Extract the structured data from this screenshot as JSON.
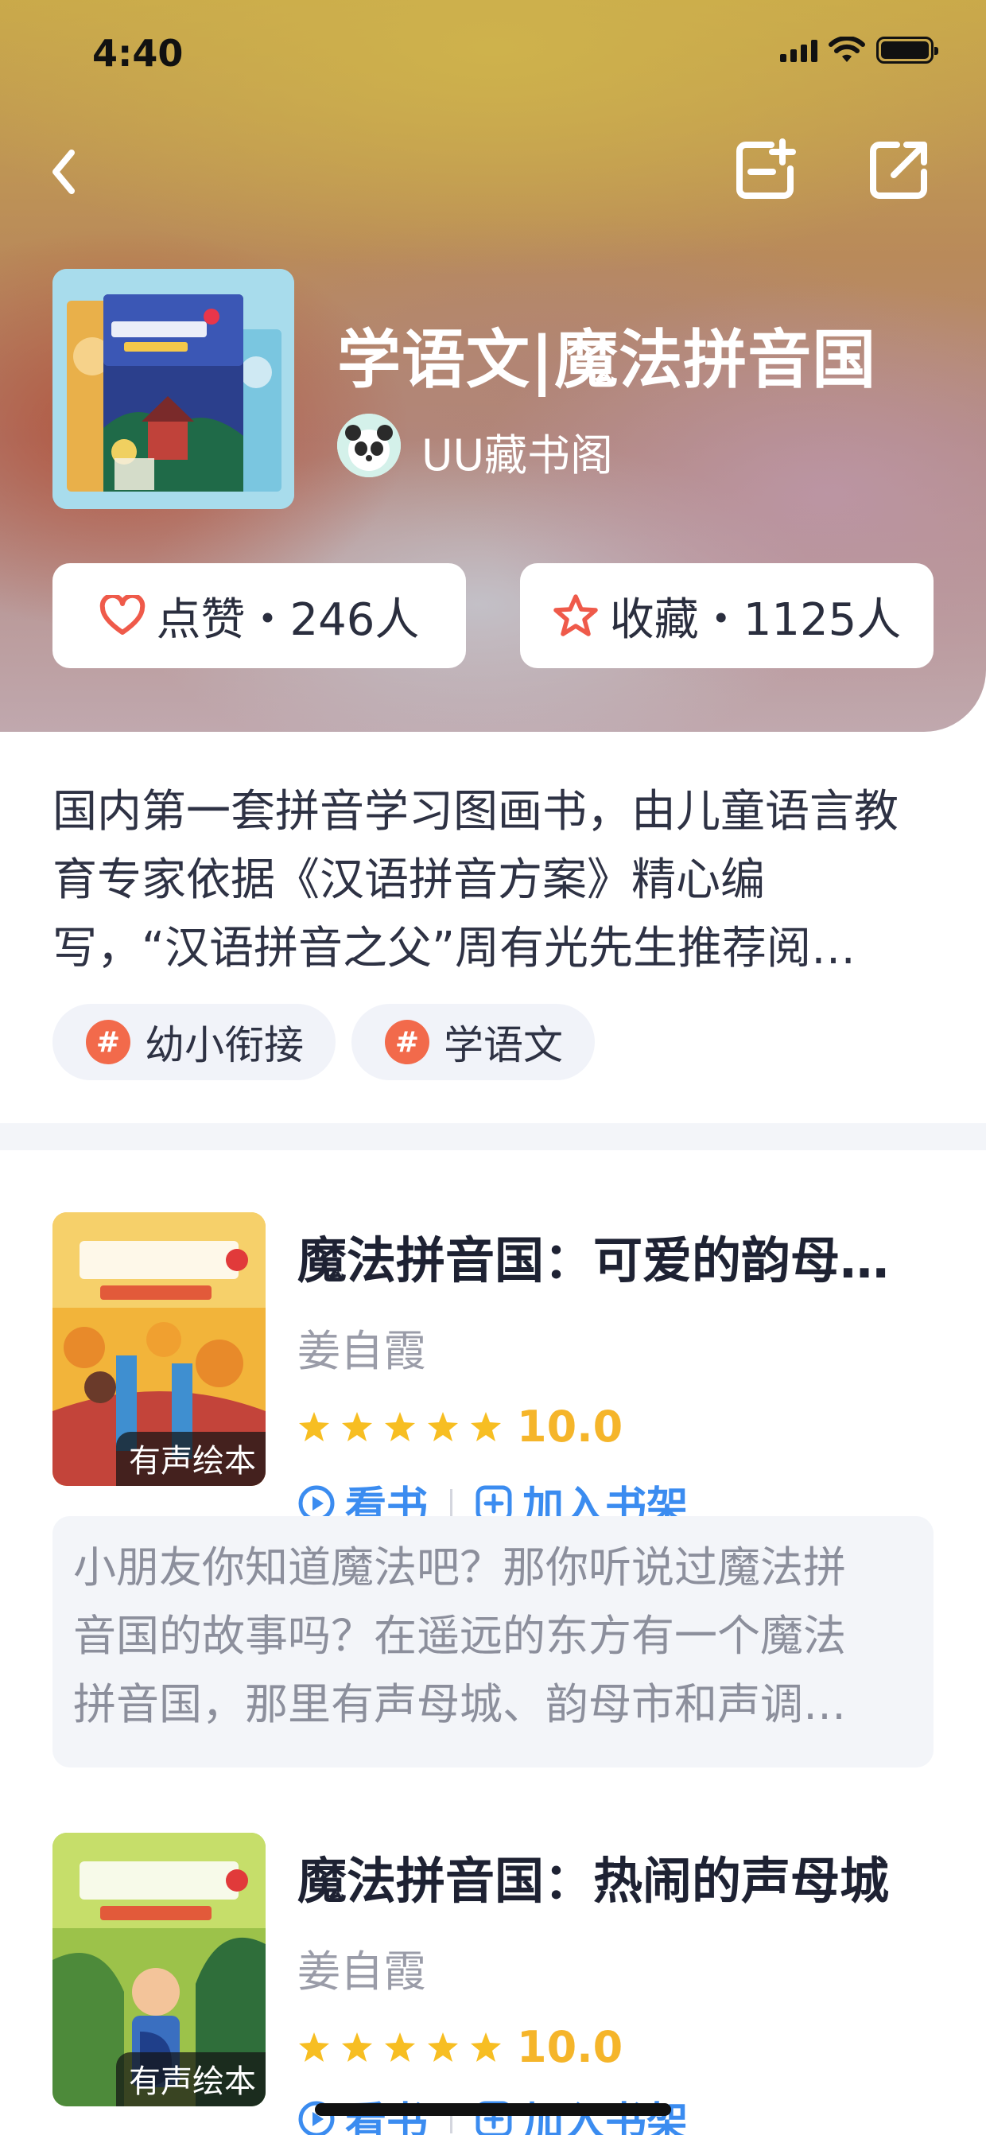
{
  "status_bar": {
    "time": "4:40"
  },
  "header": {
    "title": "学语文|魔法拼音国",
    "author": "UU藏书阁",
    "like_label": "点赞・246人",
    "fav_label": "收藏・1125人"
  },
  "description": {
    "lines": [
      "国内第一套拼音学习图画书，由儿童语言教",
      "育专家依据《汉语拼音方案》精心编",
      "写，“汉语拼音之父”周有光先生推荐阅…"
    ],
    "tags": [
      "幼小衔接",
      "学语文"
    ]
  },
  "books": [
    {
      "title": "魔法拼音国：可爱的韵母…",
      "author": "姜自霞",
      "badge": "有声绘本",
      "rating": "10.0",
      "read_label": "看书",
      "shelf_label": "加入书架",
      "summary": [
        "小朋友你知道魔法吧？那你听说过魔法拼",
        "音国的故事吗？在遥远的东方有一个魔法",
        "拼音国，那里有声母城、韵母市和声调…"
      ]
    },
    {
      "title": "魔法拼音国：热闹的声母城",
      "author": "姜自霞",
      "badge": "有声绘本",
      "rating": "10.0",
      "read_label": "看书",
      "shelf_label": "加入书架"
    }
  ],
  "colors": {
    "accent_blue": "#3b8cf0",
    "star_yellow": "#f7be22",
    "tag_orange": "#f26a4b",
    "like_red": "#ef5a4a"
  },
  "icons": [
    "back-icon",
    "add-note-icon",
    "share-icon",
    "heart-icon",
    "star-icon",
    "hash-icon",
    "play-circle-icon",
    "plus-square-icon"
  ]
}
